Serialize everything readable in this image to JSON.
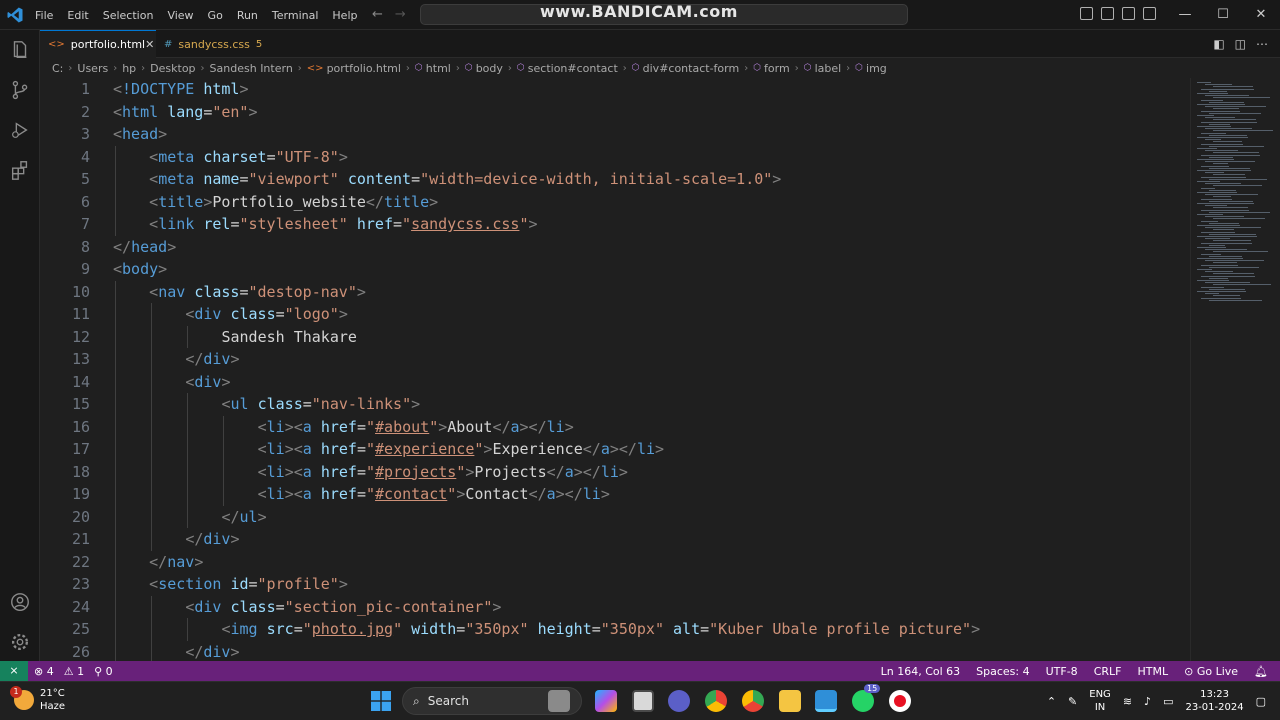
{
  "titlebar": {
    "menu": [
      "File",
      "Edit",
      "Selection",
      "View",
      "Go",
      "Run",
      "Terminal",
      "Help"
    ],
    "watermark": "www.BANDICAM.com",
    "window_controls": [
      "—",
      "☐",
      "✕"
    ]
  },
  "tabs": [
    {
      "label": "portfolio.html",
      "active": true,
      "close": "✕"
    },
    {
      "label": "sandycss.css",
      "active": false,
      "badge": "5"
    }
  ],
  "breadcrumb": [
    "C:",
    "Users",
    "hp",
    "Desktop",
    "Sandesh Intern",
    "portfolio.html",
    "html",
    "body",
    "section#contact",
    "div#contact-form",
    "form",
    "label",
    "img"
  ],
  "code_lines": [
    {
      "n": "1",
      "indent": 0,
      "tokens": [
        [
          "br",
          "<"
        ],
        [
          "tg",
          "!DOCTYPE"
        ],
        [
          "tx",
          " "
        ],
        [
          "at",
          "html"
        ],
        [
          "br",
          ">"
        ]
      ]
    },
    {
      "n": "2",
      "indent": 0,
      "tokens": [
        [
          "br",
          "<"
        ],
        [
          "tg",
          "html"
        ],
        [
          "tx",
          " "
        ],
        [
          "at",
          "lang"
        ],
        [
          "tx",
          "="
        ],
        [
          "st",
          "\"en\""
        ],
        [
          "br",
          ">"
        ]
      ]
    },
    {
      "n": "3",
      "indent": 0,
      "tokens": [
        [
          "br",
          "<"
        ],
        [
          "tg",
          "head"
        ],
        [
          "br",
          ">"
        ]
      ]
    },
    {
      "n": "4",
      "indent": 1,
      "tokens": [
        [
          "br",
          "<"
        ],
        [
          "tg",
          "meta"
        ],
        [
          "tx",
          " "
        ],
        [
          "at",
          "charset"
        ],
        [
          "tx",
          "="
        ],
        [
          "st",
          "\"UTF-8\""
        ],
        [
          "br",
          ">"
        ]
      ]
    },
    {
      "n": "5",
      "indent": 1,
      "tokens": [
        [
          "br",
          "<"
        ],
        [
          "tg",
          "meta"
        ],
        [
          "tx",
          " "
        ],
        [
          "at",
          "name"
        ],
        [
          "tx",
          "="
        ],
        [
          "st",
          "\"viewport\""
        ],
        [
          "tx",
          " "
        ],
        [
          "at",
          "content"
        ],
        [
          "tx",
          "="
        ],
        [
          "st",
          "\"width=device-width, initial-scale=1.0\""
        ],
        [
          "br",
          ">"
        ]
      ]
    },
    {
      "n": "6",
      "indent": 1,
      "tokens": [
        [
          "br",
          "<"
        ],
        [
          "tg",
          "title"
        ],
        [
          "br",
          ">"
        ],
        [
          "tx",
          "Portfolio_website"
        ],
        [
          "br",
          "</"
        ],
        [
          "tg",
          "title"
        ],
        [
          "br",
          ">"
        ]
      ]
    },
    {
      "n": "7",
      "indent": 1,
      "tokens": [
        [
          "br",
          "<"
        ],
        [
          "tg",
          "link"
        ],
        [
          "tx",
          " "
        ],
        [
          "at",
          "rel"
        ],
        [
          "tx",
          "="
        ],
        [
          "st",
          "\"stylesheet\""
        ],
        [
          "tx",
          " "
        ],
        [
          "at",
          "href"
        ],
        [
          "tx",
          "="
        ],
        [
          "st",
          "\""
        ],
        [
          "stu",
          "sandycss.css"
        ],
        [
          "st",
          "\""
        ],
        [
          "br",
          ">"
        ]
      ]
    },
    {
      "n": "8",
      "indent": 0,
      "tokens": [
        [
          "br",
          "</"
        ],
        [
          "tg",
          "head"
        ],
        [
          "br",
          ">"
        ]
      ]
    },
    {
      "n": "9",
      "indent": 0,
      "tokens": [
        [
          "br",
          "<"
        ],
        [
          "tg",
          "body"
        ],
        [
          "br",
          ">"
        ]
      ]
    },
    {
      "n": "10",
      "indent": 1,
      "tokens": [
        [
          "br",
          "<"
        ],
        [
          "tg",
          "nav"
        ],
        [
          "tx",
          " "
        ],
        [
          "at",
          "class"
        ],
        [
          "tx",
          "="
        ],
        [
          "st",
          "\"destop-nav\""
        ],
        [
          "br",
          ">"
        ]
      ]
    },
    {
      "n": "11",
      "indent": 2,
      "tokens": [
        [
          "br",
          "<"
        ],
        [
          "tg",
          "div"
        ],
        [
          "tx",
          " "
        ],
        [
          "at",
          "class"
        ],
        [
          "tx",
          "="
        ],
        [
          "st",
          "\"logo\""
        ],
        [
          "br",
          ">"
        ]
      ]
    },
    {
      "n": "12",
      "indent": 3,
      "tokens": [
        [
          "tx",
          "Sandesh Thakare"
        ]
      ]
    },
    {
      "n": "13",
      "indent": 2,
      "tokens": [
        [
          "br",
          "</"
        ],
        [
          "tg",
          "div"
        ],
        [
          "br",
          ">"
        ]
      ]
    },
    {
      "n": "14",
      "indent": 2,
      "tokens": [
        [
          "br",
          "<"
        ],
        [
          "tg",
          "div"
        ],
        [
          "br",
          ">"
        ]
      ]
    },
    {
      "n": "15",
      "indent": 3,
      "tokens": [
        [
          "br",
          "<"
        ],
        [
          "tg",
          "ul"
        ],
        [
          "tx",
          " "
        ],
        [
          "at",
          "class"
        ],
        [
          "tx",
          "="
        ],
        [
          "st",
          "\"nav-links\""
        ],
        [
          "br",
          ">"
        ]
      ]
    },
    {
      "n": "16",
      "indent": 4,
      "tokens": [
        [
          "br",
          "<"
        ],
        [
          "tg",
          "li"
        ],
        [
          "br",
          "><"
        ],
        [
          "tg",
          "a"
        ],
        [
          "tx",
          " "
        ],
        [
          "at",
          "href"
        ],
        [
          "tx",
          "="
        ],
        [
          "st",
          "\""
        ],
        [
          "stu",
          "#about"
        ],
        [
          "st",
          "\""
        ],
        [
          "br",
          ">"
        ],
        [
          "tx",
          "About"
        ],
        [
          "br",
          "</"
        ],
        [
          "tg",
          "a"
        ],
        [
          "br",
          "></"
        ],
        [
          "tg",
          "li"
        ],
        [
          "br",
          ">"
        ]
      ]
    },
    {
      "n": "17",
      "indent": 4,
      "tokens": [
        [
          "br",
          "<"
        ],
        [
          "tg",
          "li"
        ],
        [
          "br",
          "><"
        ],
        [
          "tg",
          "a"
        ],
        [
          "tx",
          " "
        ],
        [
          "at",
          "href"
        ],
        [
          "tx",
          "="
        ],
        [
          "st",
          "\""
        ],
        [
          "stu",
          "#experience"
        ],
        [
          "st",
          "\""
        ],
        [
          "br",
          ">"
        ],
        [
          "tx",
          "Experience"
        ],
        [
          "br",
          "</"
        ],
        [
          "tg",
          "a"
        ],
        [
          "br",
          "></"
        ],
        [
          "tg",
          "li"
        ],
        [
          "br",
          ">"
        ]
      ]
    },
    {
      "n": "18",
      "indent": 4,
      "tokens": [
        [
          "br",
          "<"
        ],
        [
          "tg",
          "li"
        ],
        [
          "br",
          "><"
        ],
        [
          "tg",
          "a"
        ],
        [
          "tx",
          " "
        ],
        [
          "at",
          "href"
        ],
        [
          "tx",
          "="
        ],
        [
          "st",
          "\""
        ],
        [
          "stu",
          "#projects"
        ],
        [
          "st",
          "\""
        ],
        [
          "br",
          ">"
        ],
        [
          "tx",
          "Projects"
        ],
        [
          "br",
          "</"
        ],
        [
          "tg",
          "a"
        ],
        [
          "br",
          "></"
        ],
        [
          "tg",
          "li"
        ],
        [
          "br",
          ">"
        ]
      ]
    },
    {
      "n": "19",
      "indent": 4,
      "tokens": [
        [
          "br",
          "<"
        ],
        [
          "tg",
          "li"
        ],
        [
          "br",
          "><"
        ],
        [
          "tg",
          "a"
        ],
        [
          "tx",
          " "
        ],
        [
          "at",
          "href"
        ],
        [
          "tx",
          "="
        ],
        [
          "st",
          "\""
        ],
        [
          "stu",
          "#contact"
        ],
        [
          "st",
          "\""
        ],
        [
          "br",
          ">"
        ],
        [
          "tx",
          "Contact"
        ],
        [
          "br",
          "</"
        ],
        [
          "tg",
          "a"
        ],
        [
          "br",
          "></"
        ],
        [
          "tg",
          "li"
        ],
        [
          "br",
          ">"
        ]
      ]
    },
    {
      "n": "20",
      "indent": 3,
      "tokens": [
        [
          "br",
          "</"
        ],
        [
          "tg",
          "ul"
        ],
        [
          "br",
          ">"
        ]
      ]
    },
    {
      "n": "21",
      "indent": 2,
      "tokens": [
        [
          "br",
          "</"
        ],
        [
          "tg",
          "div"
        ],
        [
          "br",
          ">"
        ]
      ]
    },
    {
      "n": "22",
      "indent": 1,
      "tokens": [
        [
          "br",
          "</"
        ],
        [
          "tg",
          "nav"
        ],
        [
          "br",
          ">"
        ]
      ]
    },
    {
      "n": "23",
      "indent": 1,
      "tokens": [
        [
          "br",
          "<"
        ],
        [
          "tg",
          "section"
        ],
        [
          "tx",
          " "
        ],
        [
          "at",
          "id"
        ],
        [
          "tx",
          "="
        ],
        [
          "st",
          "\"profile\""
        ],
        [
          "br",
          ">"
        ]
      ]
    },
    {
      "n": "24",
      "indent": 2,
      "tokens": [
        [
          "br",
          "<"
        ],
        [
          "tg",
          "div"
        ],
        [
          "tx",
          " "
        ],
        [
          "at",
          "class"
        ],
        [
          "tx",
          "="
        ],
        [
          "st",
          "\"section_pic-container\""
        ],
        [
          "br",
          ">"
        ]
      ]
    },
    {
      "n": "25",
      "indent": 3,
      "tokens": [
        [
          "br",
          "<"
        ],
        [
          "tg",
          "img"
        ],
        [
          "tx",
          " "
        ],
        [
          "at",
          "src"
        ],
        [
          "tx",
          "="
        ],
        [
          "st",
          "\""
        ],
        [
          "stu",
          "photo.jpg"
        ],
        [
          "st",
          "\""
        ],
        [
          "tx",
          " "
        ],
        [
          "at",
          "width"
        ],
        [
          "tx",
          "="
        ],
        [
          "st",
          "\"350px\""
        ],
        [
          "tx",
          " "
        ],
        [
          "at",
          "height"
        ],
        [
          "tx",
          "="
        ],
        [
          "st",
          "\"350px\""
        ],
        [
          "tx",
          " "
        ],
        [
          "at",
          "alt"
        ],
        [
          "tx",
          "="
        ],
        [
          "st",
          "\"Kuber Ubale profile picture\""
        ],
        [
          "br",
          ">"
        ]
      ]
    },
    {
      "n": "26",
      "indent": 2,
      "tokens": [
        [
          "br",
          "</"
        ],
        [
          "tg",
          "div"
        ],
        [
          "br",
          ">"
        ]
      ]
    }
  ],
  "statusbar": {
    "remote": "⨯",
    "errors": "⊗ 4",
    "warnings": "⚠ 1",
    "ports": "⚲ 0",
    "position": "Ln 164, Col 63",
    "spaces": "Spaces: 4",
    "encoding": "UTF-8",
    "eol": "CRLF",
    "language": "HTML",
    "golive": "Go Live"
  },
  "taskbar": {
    "temp": "21°C",
    "weather": "Haze",
    "weather_badge": "1",
    "search": "Search",
    "lang1": "ENG",
    "lang2": "IN",
    "time": "13:23",
    "date": "23-01-2024",
    "whatsapp_badge": "15"
  },
  "colors": {
    "tag": "#569cd6",
    "attr": "#9cdcfe",
    "string": "#ce9178",
    "text": "#d4d4d4",
    "status_bg": "#68217a",
    "editor_bg": "#1f1f1f"
  }
}
